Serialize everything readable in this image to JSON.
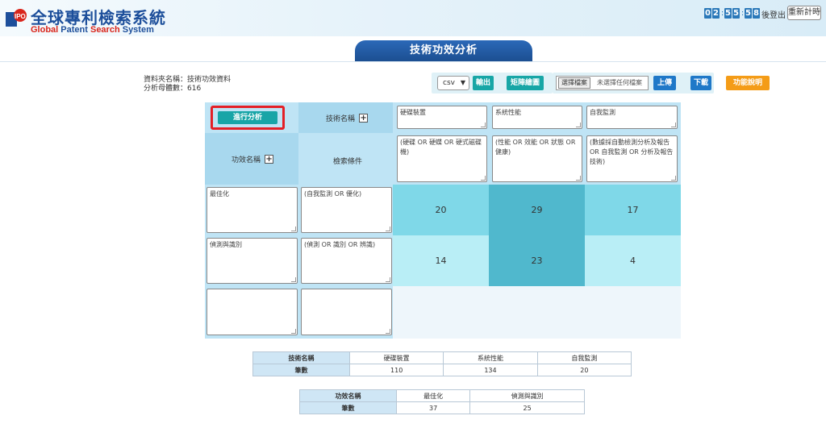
{
  "header": {
    "logo_cn": "全球專利檢索系統",
    "logo_en": [
      "Global",
      " Patent",
      " Search",
      " System"
    ],
    "timer_digits": [
      "0",
      "2",
      "5",
      "5",
      "5",
      "8"
    ],
    "logout_label": "後登出",
    "reset_label": "重新計時"
  },
  "page_title": "技術功效分析",
  "meta": {
    "folder_label": "資料夾名稱：技術功效資料",
    "count_label": "分析母體數：616"
  },
  "toolbar": {
    "format_value": "csv",
    "export_label": "輸出",
    "matrix_plot_label": "矩陣繪圖",
    "choose_file_label": "選擇檔案",
    "file_status": "未選擇任何檔案",
    "upload_label": "上傳",
    "download_label": "下載",
    "help_label": "功能說明"
  },
  "matrix": {
    "run_label": "進行分析",
    "tech_header_label": "技術名稱",
    "effect_header_label": "功效名稱",
    "query_header_label": "檢索條件",
    "tech_names": [
      "硬碟裝置",
      "系統性能",
      "自我監測"
    ],
    "tech_queries": [
      "(硬碟 OR 硬蝶 OR 硬式磁碟機)",
      "(性能 OR 效能 OR 狀態 OR 健康)",
      "(數據採自動檢測分析及報告 OR 自我監測 OR 分析及報告技術)"
    ],
    "effects": [
      {
        "name": "最佳化",
        "query": "(自我監測 OR 優化)",
        "values": [
          "20",
          "29",
          "17"
        ]
      },
      {
        "name": "偵測與識別",
        "query": "(偵測 OR 識別 OR 辨識)",
        "values": [
          "14",
          "23",
          "4"
        ]
      }
    ],
    "cell_colors": [
      [
        "#7fd8e8",
        "#50b8cd",
        "#7fd8e8"
      ],
      [
        "#b9eef6",
        "#50b8cd",
        "#b9eef6"
      ]
    ]
  },
  "tech_summary": {
    "row_headers": [
      "技術名稱",
      "筆數"
    ],
    "names": [
      "硬碟裝置",
      "系統性能",
      "自我監測"
    ],
    "counts": [
      "110",
      "134",
      "20"
    ]
  },
  "effect_summary": {
    "row_headers": [
      "功效名稱",
      "筆數"
    ],
    "names": [
      "最佳化",
      "偵測與識別"
    ],
    "counts": [
      "37",
      "25"
    ]
  }
}
